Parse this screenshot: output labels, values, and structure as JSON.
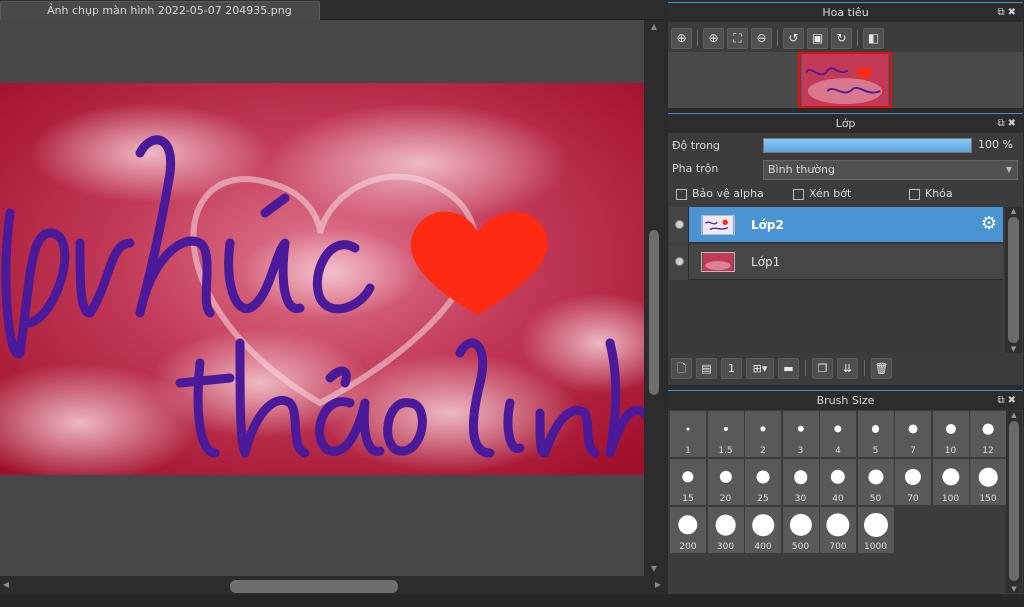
{
  "document": {
    "tab_title": "Ảnh chụp màn hình 2022-05-07 204935.png"
  },
  "artwork": {
    "text_line1": "phúc",
    "text_line2": "thảolinh",
    "colors": {
      "background": "#b0203a",
      "ink": "#4a1a9a",
      "heart": "#ff2a12"
    }
  },
  "navigator": {
    "title": "Hoa tiêu",
    "tools": [
      "zoom-in-icon",
      "zoom-in-icon",
      "fit-screen-icon",
      "zoom-out-icon",
      "rotate-left-icon",
      "fullscreen-icon",
      "rotate-right-icon",
      "flip-icon"
    ]
  },
  "layers": {
    "title": "Lớp",
    "opacity_label": "Độ trong",
    "opacity_value": "100 %",
    "opacity_fraction": 1.0,
    "blend_label": "Pha trộn",
    "blend_value": "Bình thường",
    "protect_alpha": "Bảo vệ alpha",
    "clipping": "Xén bớt",
    "lock": "Khóa",
    "items": [
      {
        "name": "Lớp2",
        "selected": true
      },
      {
        "name": "Lớp1",
        "selected": false
      }
    ]
  },
  "brush_size": {
    "title": "Brush Size",
    "sizes": [
      "1",
      "1.5",
      "2",
      "3",
      "4",
      "5",
      "7",
      "10",
      "12",
      "15",
      "20",
      "25",
      "30",
      "40",
      "50",
      "70",
      "100",
      "150",
      "200",
      "300",
      "400",
      "500",
      "700",
      "1000"
    ]
  }
}
